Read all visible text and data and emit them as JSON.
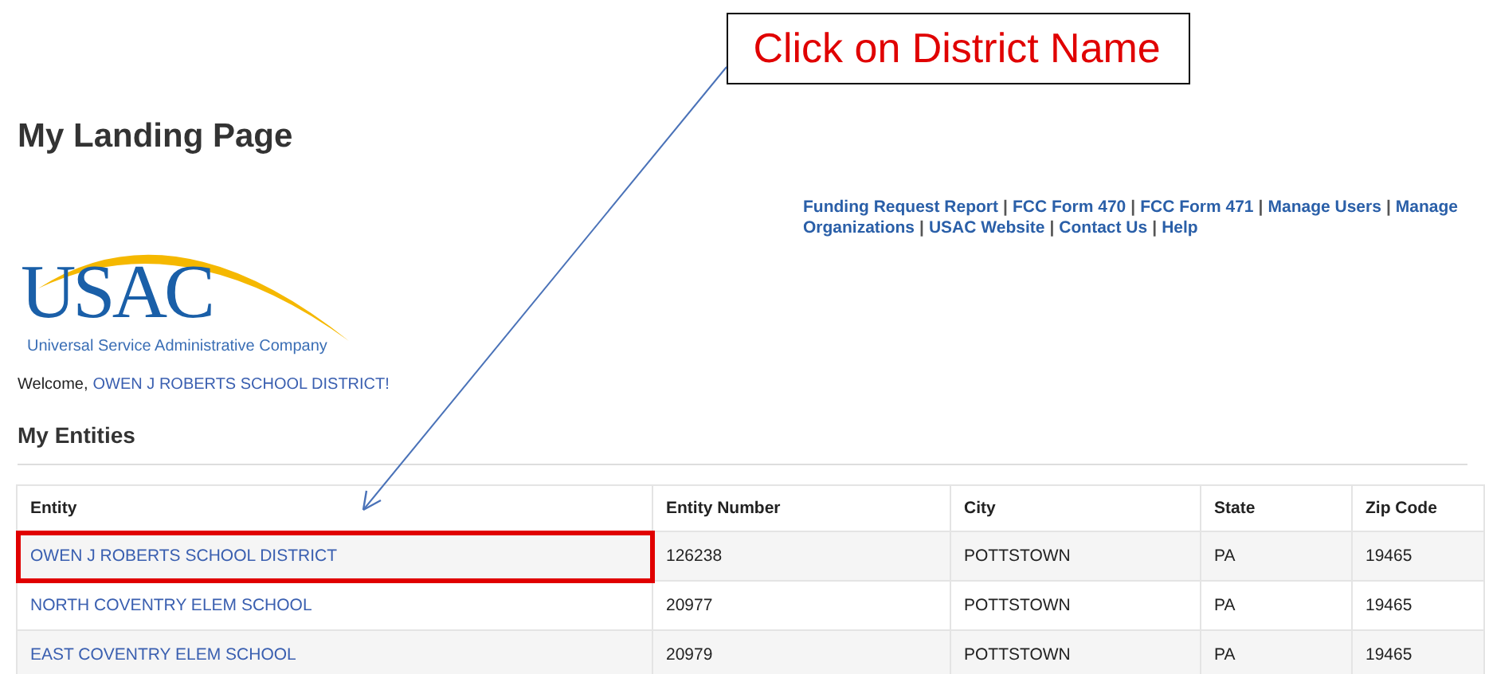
{
  "callout": {
    "text": "Click on District Name"
  },
  "page_title": "My Landing Page",
  "separator": "|",
  "nav_lines": [
    [
      "Funding Request Report",
      "FCC Form 470",
      "FCC Form 471",
      "Manage Users",
      "Manage"
    ],
    [
      "Organizations",
      "USAC Website",
      "Contact Us",
      "Help"
    ]
  ],
  "logo": {
    "wordmark": "USAC",
    "tagline": "Universal Service Administrative Company"
  },
  "welcome": {
    "label": "Welcome,",
    "name": "OWEN J ROBERTS SCHOOL DISTRICT!"
  },
  "section_title": "My Entities",
  "table": {
    "columns": [
      "Entity",
      "Entity Number",
      "City",
      "State",
      "Zip Code"
    ],
    "rows": [
      {
        "entity": "OWEN J ROBERTS SCHOOL DISTRICT",
        "number": "126238",
        "city": "POTTSTOWN",
        "state": "PA",
        "zip": "19465",
        "highlighted": true
      },
      {
        "entity": "NORTH COVENTRY ELEM SCHOOL",
        "number": "20977",
        "city": "POTTSTOWN",
        "state": "PA",
        "zip": "19465",
        "highlighted": false
      },
      {
        "entity": "EAST COVENTRY ELEM SCHOOL",
        "number": "20979",
        "city": "POTTSTOWN",
        "state": "PA",
        "zip": "19465",
        "highlighted": false
      }
    ]
  }
}
